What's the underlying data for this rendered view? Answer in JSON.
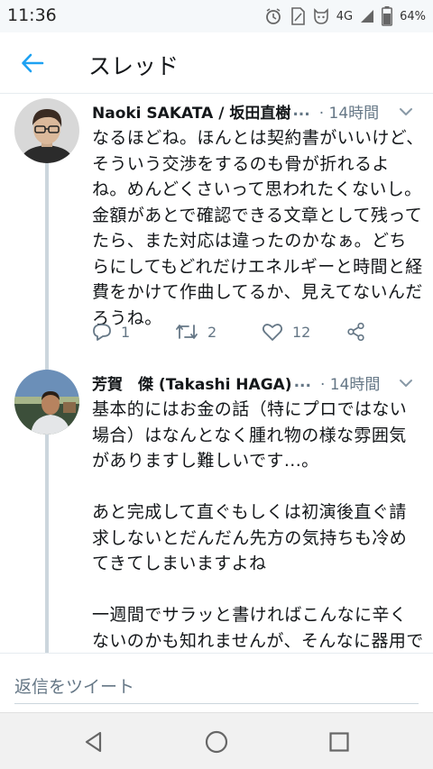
{
  "status_bar": {
    "time": "11:36",
    "network": "4G",
    "battery_percent": "64%",
    "icons": [
      "alarm-icon",
      "sim-icon",
      "cat-icon",
      "signal-icon",
      "battery-icon"
    ]
  },
  "header": {
    "title": "スレッド",
    "back_icon": "back-arrow-icon",
    "accent_color": "#1da1f2"
  },
  "tweets": [
    {
      "author": "Naoki SAKATA / 坂田直樹",
      "ellipsis": "...",
      "time": "· 14時間",
      "text": "なるほどね。ほんとは契約書がいいけど、そういう交渉をするのも骨が折れるよね。めんどくさいって思われたくないし。金額があとで確認できる文章として残ってたら、また対応は違ったのかなぁ。どちらにしてもどれだけエネルギーと時間と経費をかけて作曲してるか、見えてないんだろうね。",
      "replies": "1",
      "retweets": "2",
      "likes": "12"
    },
    {
      "author": "芳賀　傑 (Takashi HAGA)",
      "ellipsis": "...",
      "time": "· 14時間",
      "text": "基本的にはお金の話（特にプロではない場合）はなんとなく腫れ物の様な雰囲気がありますし難しいです...。\n\nあと完成して直ぐもしくは初演後直ぐ請求しないとだんだん先方の気持ちも冷めてきてしまいますよね\n\n一週間でサラッと書ければこんなに辛くないのかも知れませんが、そんなに器用ではないので..."
    }
  ],
  "reply_bar": {
    "placeholder": "返信をツイート"
  },
  "nav_bar": {
    "buttons": [
      "back-triangle-icon",
      "home-circle-icon",
      "recents-square-icon"
    ]
  }
}
